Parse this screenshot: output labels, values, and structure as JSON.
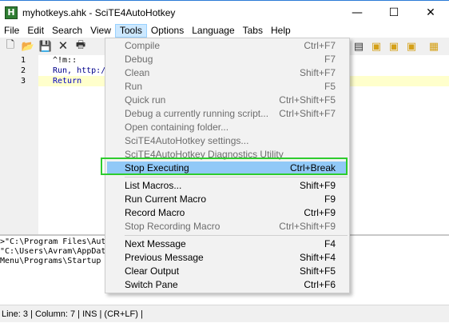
{
  "window": {
    "title": "myhotkeys.ahk - SciTE4AutoHotkey",
    "icon": "autohotkey-h-icon",
    "buttons": [
      "minimize-icon",
      "maximize-icon",
      "close-icon"
    ]
  },
  "menubar": [
    "File",
    "Edit",
    "Search",
    "View",
    "Tools",
    "Options",
    "Language",
    "Tabs",
    "Help"
  ],
  "editor": {
    "line_numbers": [
      "1",
      "2",
      "3"
    ],
    "lines": [
      {
        "text": "^!m::",
        "style": "plain"
      },
      {
        "text": "Run, http:/",
        "style": "cmd"
      },
      {
        "text": "Return",
        "style": "kw"
      }
    ]
  },
  "output": [
    ">\"C:\\Program Files\\Aut",
    "\"C:\\Users\\Avram\\AppDat",
    "Menu\\Programs\\Startup"
  ],
  "status": "Line: 3 | Column: 7 | INS | (CR+LF) |",
  "tools_menu": {
    "groups": [
      [
        {
          "label": "Compile",
          "shortcut": "Ctrl+F7",
          "disabled": true
        },
        {
          "label": "Debug",
          "shortcut": "F7",
          "disabled": true
        },
        {
          "label": "Clean",
          "shortcut": "Shift+F7",
          "disabled": true
        },
        {
          "label": "Run",
          "shortcut": "F5",
          "disabled": true
        },
        {
          "label": "Quick run",
          "shortcut": "Ctrl+Shift+F5",
          "disabled": true
        },
        {
          "label": "Debug a currently running script...",
          "shortcut": "Ctrl+Shift+F7",
          "disabled": true
        },
        {
          "label": "Open containing folder...",
          "shortcut": "",
          "disabled": true
        },
        {
          "label": "SciTE4AutoHotkey settings...",
          "shortcut": "",
          "disabled": true
        },
        {
          "label": "SciTE4AutoHotkey Diagnostics Utility",
          "shortcut": "",
          "disabled": true
        },
        {
          "label": "Stop Executing",
          "shortcut": "Ctrl+Break",
          "disabled": false,
          "highlighted": true
        }
      ],
      [
        {
          "label": "List Macros...",
          "shortcut": "Shift+F9",
          "disabled": false
        },
        {
          "label": "Run Current Macro",
          "shortcut": "F9",
          "disabled": false
        },
        {
          "label": "Record Macro",
          "shortcut": "Ctrl+F9",
          "disabled": false
        },
        {
          "label": "Stop Recording Macro",
          "shortcut": "Ctrl+Shift+F9",
          "disabled": true
        }
      ],
      [
        {
          "label": "Next Message",
          "shortcut": "F4",
          "disabled": false
        },
        {
          "label": "Previous Message",
          "shortcut": "Shift+F4",
          "disabled": false
        },
        {
          "label": "Clear Output",
          "shortcut": "Shift+F5",
          "disabled": false
        },
        {
          "label": "Switch Pane",
          "shortcut": "Ctrl+F6",
          "disabled": false
        }
      ]
    ]
  },
  "highlight_color": "#2ecc2e"
}
